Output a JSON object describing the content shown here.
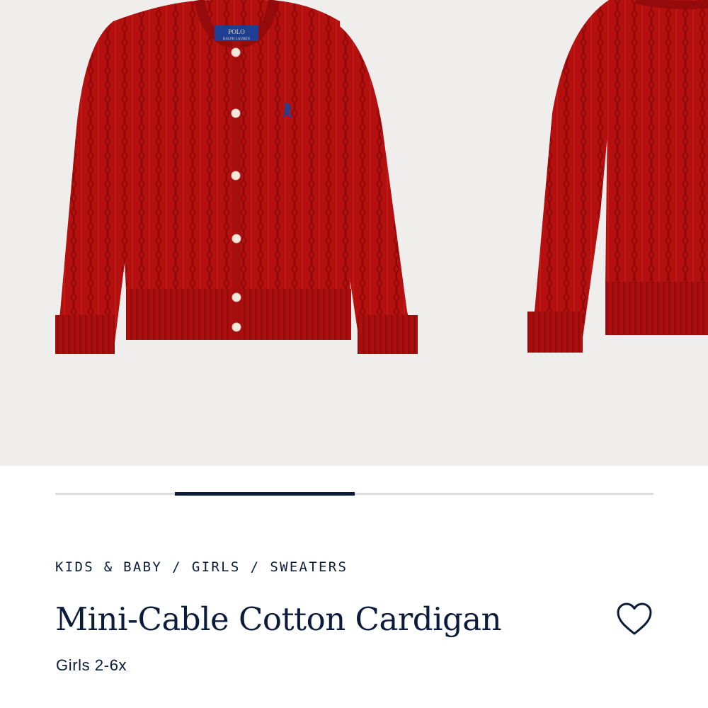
{
  "product": {
    "breadcrumb": [
      "KIDS & BABY",
      "GIRLS",
      "SWEATERS"
    ],
    "separator": "/",
    "title": "Mini-Cable Cotton Cardigan",
    "subtitle": "Girls 2-6x",
    "label_text": [
      "POLO",
      "RALPH LAUREN"
    ]
  },
  "gallery": {
    "image_count": 2,
    "progress": 0.3,
    "progress_start": 0.2,
    "colors": {
      "background": "#efeeed",
      "sweater": "#b3100f",
      "label": "#1f3f95",
      "navy": "#0b1b3a"
    }
  },
  "icons": {
    "favorite": "heart-outline-icon"
  }
}
